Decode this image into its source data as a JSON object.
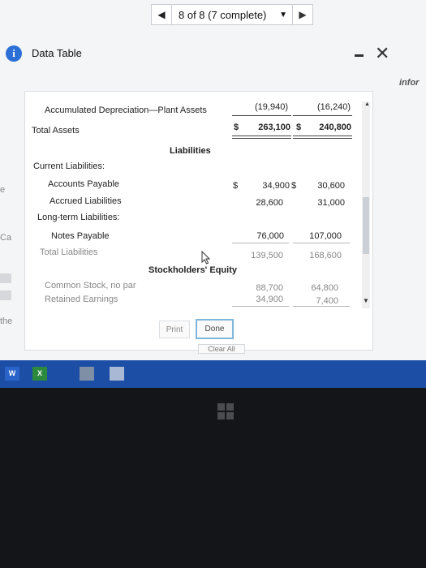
{
  "progress": {
    "label": "8 of 8 (7 complete)"
  },
  "dialog": {
    "title": "Data Table"
  },
  "background": {
    "side_text": "infor",
    "left_text_1": "e",
    "left_text_2": "Ca",
    "left_text_3": "the"
  },
  "table": {
    "rows": {
      "acc_dep": {
        "label": "Accumulated Depreciation—Plant Assets",
        "v1": "(19,940)",
        "v2": "(16,240)"
      },
      "total_assets": {
        "label": "Total Assets",
        "cur1": "$",
        "v1": "263,100",
        "cur2": "$",
        "v2": "240,800"
      },
      "liabilities_heading": "Liabilities",
      "current_liabilities": "Current Liabilities:",
      "accounts_payable": {
        "label": "Accounts Payable",
        "cur1": "$",
        "v1": "34,900",
        "cur2": "$",
        "v2": "30,600"
      },
      "accrued_liabilities": {
        "label": "Accrued Liabilities",
        "v1": "28,600",
        "v2": "31,000"
      },
      "long_term": "Long-term Liabilities:",
      "notes_payable": {
        "label": "Notes Payable",
        "v1": "76,000",
        "v2": "107,000"
      },
      "total_liabilities": {
        "label": "Total Liabilities",
        "v1": "139,500",
        "v2": "168,600"
      },
      "equity_heading": "Stockholders' Equity",
      "common_stock": {
        "label": "Common Stock, no par",
        "v1": "88,700",
        "v2": "64,800"
      },
      "retained_earnings": {
        "label": "Retained Earnings",
        "v1": "34,900",
        "v2": "7,400"
      }
    }
  },
  "buttons": {
    "print": "Print",
    "done": "Done",
    "clear_all": "Clear All"
  },
  "taskbar": {
    "word": "W",
    "excel": "X"
  }
}
